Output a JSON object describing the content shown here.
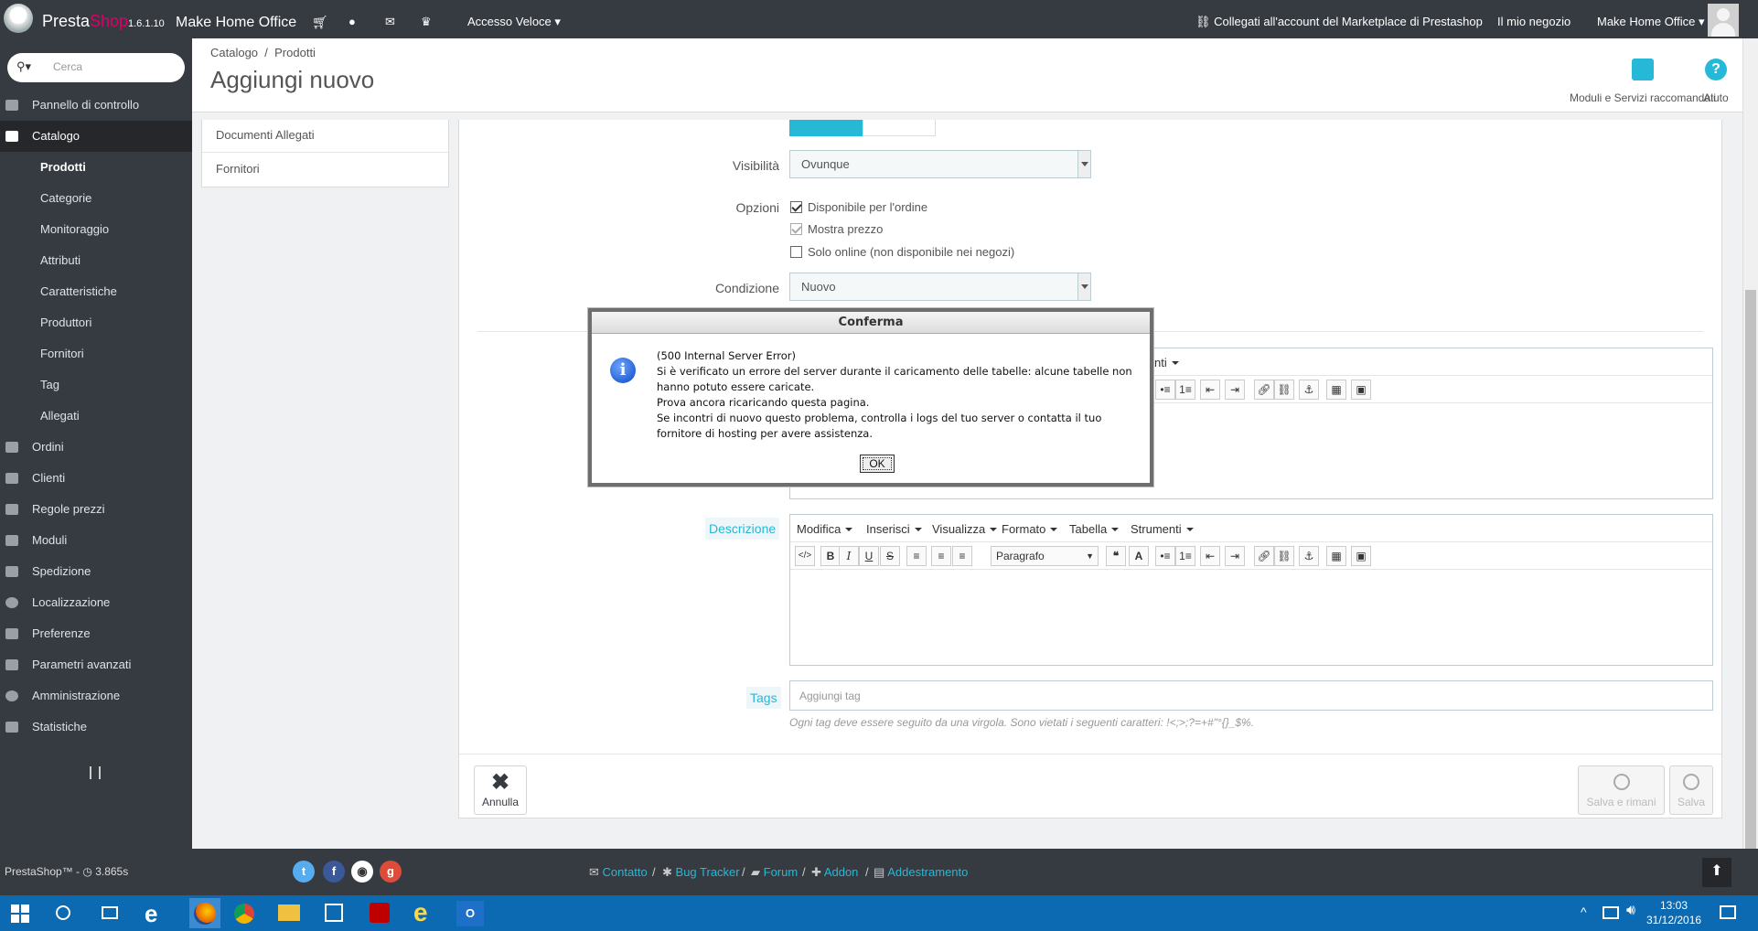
{
  "topbar": {
    "brand_a": "Presta",
    "brand_b": "Shop",
    "version": "1.6.1.10",
    "shop_name": "Make Home Office",
    "quick_access": "Accesso Veloce",
    "marketplace": "Collegati all'account del Marketplace di Prestashop",
    "my_shop": "Il mio negozio",
    "employee": "Make Home Office"
  },
  "sidebar": {
    "search_placeholder": "Cerca",
    "items": [
      {
        "label": "Pannello di controllo"
      },
      {
        "label": "Catalogo"
      },
      {
        "label": "Ordini"
      },
      {
        "label": "Clienti"
      },
      {
        "label": "Regole prezzi"
      },
      {
        "label": "Moduli"
      },
      {
        "label": "Spedizione"
      },
      {
        "label": "Localizzazione"
      },
      {
        "label": "Preferenze"
      },
      {
        "label": "Parametri avanzati"
      },
      {
        "label": "Amministrazione"
      },
      {
        "label": "Statistiche"
      }
    ],
    "sub": [
      {
        "label": "Prodotti"
      },
      {
        "label": "Categorie"
      },
      {
        "label": "Monitoraggio"
      },
      {
        "label": "Attributi"
      },
      {
        "label": "Caratteristiche"
      },
      {
        "label": "Produttori"
      },
      {
        "label": "Fornitori"
      },
      {
        "label": "Tag"
      },
      {
        "label": "Allegati"
      }
    ]
  },
  "header": {
    "breadcrumb_1": "Catalogo",
    "breadcrumb_sep": "/",
    "breadcrumb_2": "Prodotti",
    "title": "Aggiungi nuovo",
    "modules_label": "Moduli e Servizi raccomandati",
    "help_label": "Aiuto"
  },
  "tabs": {
    "documents": "Documenti Allegati",
    "suppliers": "Fornitori"
  },
  "form": {
    "visibility_label": "Visibilità",
    "visibility_value": "Ovunque",
    "options_label": "Opzioni",
    "opt_available": "Disponibile per l'ordine",
    "opt_show_price": "Mostra prezzo",
    "opt_online": "Solo online (non disponibile nei negozi)",
    "condition_label": "Condizione",
    "condition_value": "Nuovo",
    "description_label": "Descrizione",
    "tags_label": "Tags",
    "tags_placeholder": "Aggiungi tag",
    "tags_hint": "Ogni tag deve essere seguito da una virgola. Sono vietati i seguenti caratteri: !<;>;?=+#\"°{}_$%.",
    "partial_menu": "menti"
  },
  "editor": {
    "menus": [
      "Modifica",
      "Inserisci",
      "Visualizza",
      "Formato",
      "Tabella",
      "Strumenti"
    ],
    "format_value": "Paragrafo"
  },
  "buttons": {
    "cancel": "Annulla",
    "save_stay": "Salva e rimani",
    "save": "Salva"
  },
  "dialog": {
    "title": "Conferma",
    "lines": [
      "(500 Internal Server Error)",
      "Si è verificato un errore del server durante il caricamento delle tabelle: alcune tabelle non hanno potuto essere caricate.",
      "Prova ancora ricaricando questa pagina.",
      "Se incontri di nuovo questo problema, controlla i logs del tuo server o contatta il tuo fornitore di hosting per avere assistenza."
    ],
    "ok": "OK"
  },
  "footer": {
    "version_text": "PrestaShop™ - ",
    "load_time": "3.865s",
    "links": [
      "Contatto",
      "Bug Tracker",
      "Forum",
      "Addon",
      "Addestramento"
    ],
    "sep": "/"
  },
  "taskbar": {
    "time": "13:03",
    "date": "31/12/2016"
  },
  "colors": {
    "topbar": "#363a41",
    "accent": "#25b9d7",
    "taskbar": "#0b6ab1"
  }
}
